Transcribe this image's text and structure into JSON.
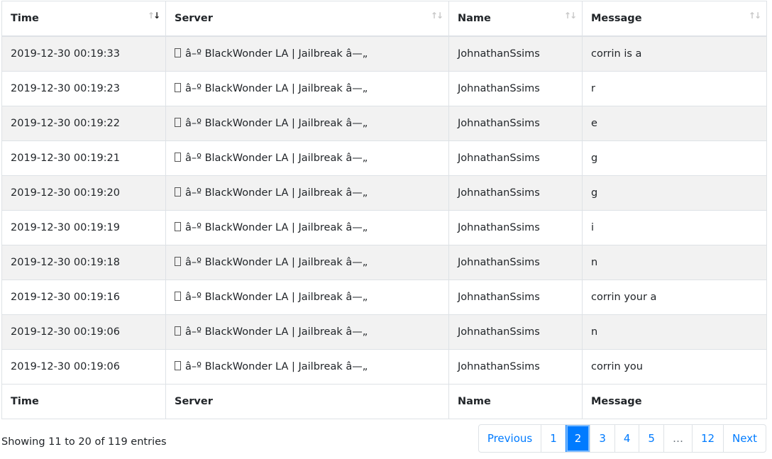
{
  "columns": [
    "Time",
    "Server",
    "Name",
    "Message"
  ],
  "rows": [
    {
      "time": "2019-12-30 00:19:33",
      "server": "â–º BlackWonder LA | Jailbreak â—„",
      "name": "JohnathanSsims",
      "message": "corrin is a"
    },
    {
      "time": "2019-12-30 00:19:23",
      "server": "â–º BlackWonder LA | Jailbreak â—„",
      "name": "JohnathanSsims",
      "message": "r"
    },
    {
      "time": "2019-12-30 00:19:22",
      "server": "â–º BlackWonder LA | Jailbreak â—„",
      "name": "JohnathanSsims",
      "message": "e"
    },
    {
      "time": "2019-12-30 00:19:21",
      "server": "â–º BlackWonder LA | Jailbreak â—„",
      "name": "JohnathanSsims",
      "message": "g"
    },
    {
      "time": "2019-12-30 00:19:20",
      "server": "â–º BlackWonder LA | Jailbreak â—„",
      "name": "JohnathanSsims",
      "message": "g"
    },
    {
      "time": "2019-12-30 00:19:19",
      "server": "â–º BlackWonder LA | Jailbreak â—„",
      "name": "JohnathanSsims",
      "message": "i"
    },
    {
      "time": "2019-12-30 00:19:18",
      "server": "â–º BlackWonder LA | Jailbreak â—„",
      "name": "JohnathanSsims",
      "message": "n"
    },
    {
      "time": "2019-12-30 00:19:16",
      "server": "â–º BlackWonder LA | Jailbreak â—„",
      "name": "JohnathanSsims",
      "message": "corrin your a"
    },
    {
      "time": "2019-12-30 00:19:06",
      "server": "â–º BlackWonder LA | Jailbreak â—„",
      "name": "JohnathanSsims",
      "message": "n"
    },
    {
      "time": "2019-12-30 00:19:06",
      "server": "â–º BlackWonder LA | Jailbreak â—„",
      "name": "JohnathanSsims",
      "message": "corrin you"
    }
  ],
  "info": "Showing 11 to 20 of 119 entries",
  "pagination": {
    "previous": "Previous",
    "pages": [
      "1",
      "2",
      "3",
      "4",
      "5",
      "…",
      "12"
    ],
    "active": "2",
    "next": "Next"
  },
  "sort": {
    "column": "Time",
    "direction": "descending"
  },
  "icons": {
    "sort": "sort-arrows-icon",
    "server_glyph": "missing-glyph-box-icon"
  },
  "colors": {
    "accent": "#007bff",
    "stripe": "#f2f2f2",
    "border": "#dee2e6"
  }
}
